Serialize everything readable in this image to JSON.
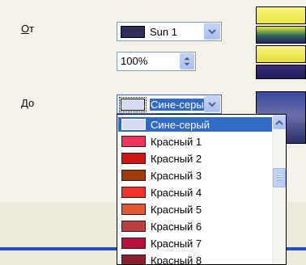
{
  "from": {
    "label_prefix": "О",
    "label_rest": "т",
    "value": "Sun 1",
    "swatch": "#2E2E5E"
  },
  "zoom": {
    "value": "100%"
  },
  "to": {
    "label_prefix": "Д",
    "label_rest": "о",
    "value": "Сине-серы",
    "swatch": "#D7DCF5"
  },
  "colors": {
    "accent": "#316AC5",
    "line": "#1F4FBF"
  },
  "list": {
    "items": [
      {
        "label": "Сине-серый",
        "color": "#D7DCF5",
        "selected": true
      },
      {
        "label": "Красный 1",
        "color": "#F0345C"
      },
      {
        "label": "Красный 2",
        "color": "#D01515"
      },
      {
        "label": "Красный 3",
        "color": "#A23A10"
      },
      {
        "label": "Красный 4",
        "color": "#F2302C"
      },
      {
        "label": "Красный 5",
        "color": "#E05636"
      },
      {
        "label": "Красный 6",
        "color": "#BC3E3E"
      },
      {
        "label": "Красный 7",
        "color": "#B5103A"
      },
      {
        "label": "Красный 8",
        "color": "#8A2030"
      }
    ]
  }
}
